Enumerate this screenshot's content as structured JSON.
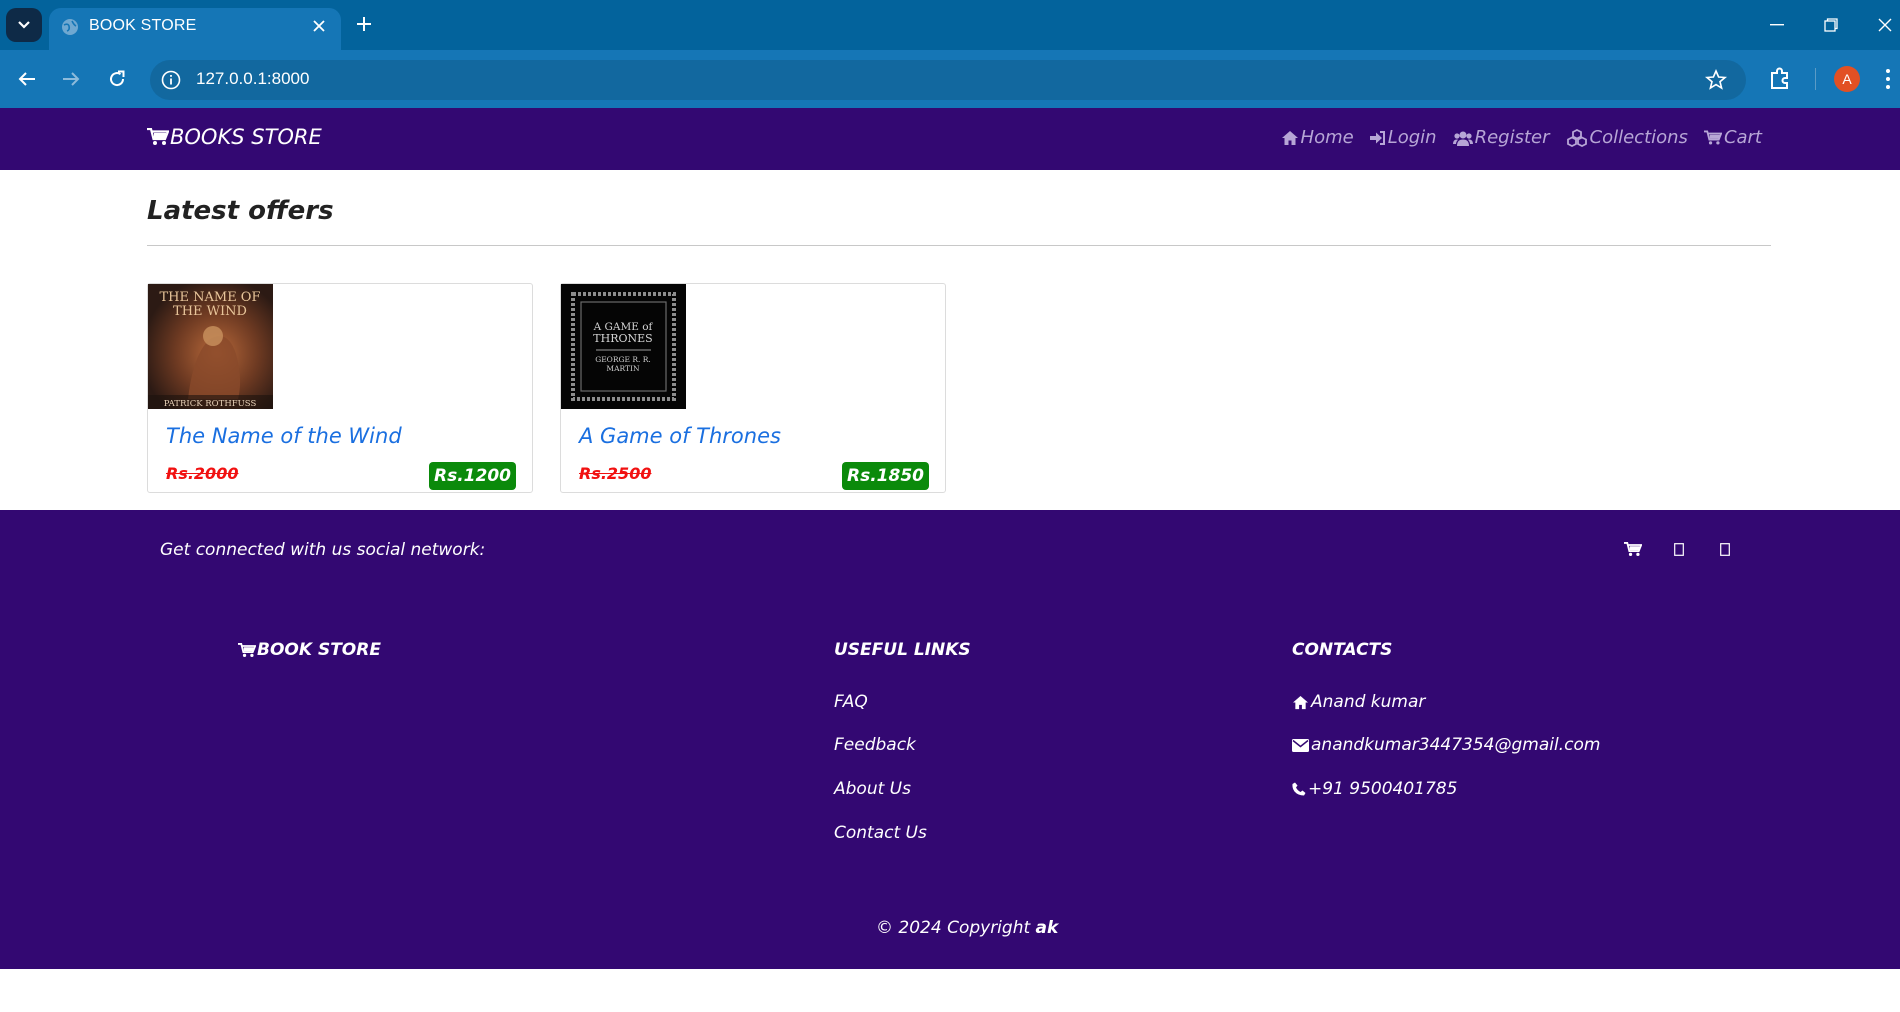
{
  "browser": {
    "tab_title": "BOOK STORE",
    "url": "127.0.0.1:8000",
    "profile_initial": "A"
  },
  "navbar": {
    "brand": "BOOKS STORE",
    "links": [
      {
        "label": "Home",
        "icon": "home-icon"
      },
      {
        "label": "Login",
        "icon": "sign-in-icon"
      },
      {
        "label": "Register",
        "icon": "users-icon"
      },
      {
        "label": "Collections",
        "icon": "cubes-icon"
      },
      {
        "label": "Cart",
        "icon": "cart-icon"
      }
    ]
  },
  "main": {
    "section_title": "Latest offers",
    "books": [
      {
        "title": "The Name of the Wind",
        "old_price": "Rs.2000",
        "new_price": "Rs.1200",
        "cover": {
          "line1": "THE NAME OF",
          "line2": "THE WIND",
          "author": "PATRICK ROTHFUSS"
        }
      },
      {
        "title": "A Game of Thrones",
        "old_price": "Rs.2500",
        "new_price": "Rs.1850",
        "cover": {
          "line1": "A GAME of",
          "line2": "THRONES",
          "author": "GEORGE R. R.",
          "author2": "MARTIN"
        }
      }
    ]
  },
  "footer": {
    "social_text": "Get connected with us social network:",
    "brand": "BOOK STORE",
    "useful_links_title": "USEFUL LINKS",
    "useful_links": [
      "FAQ",
      "Feedback",
      "About Us",
      "Contact Us"
    ],
    "contacts_title": "CONTACTS",
    "contacts": {
      "name": "Anand kumar",
      "email": "anandkumar3447354@gmail.com",
      "phone": "+91 9500401785"
    },
    "copyright_prefix": "© 2024 Copyright ",
    "copyright_owner": "ak"
  },
  "colors": {
    "chrome_dark": "#03639c",
    "chrome_light": "#1576b6",
    "navbar": "#330872",
    "link_blue": "#1a6fe0",
    "old_price_red": "#f11111",
    "new_price_green": "#0b8a0b"
  }
}
